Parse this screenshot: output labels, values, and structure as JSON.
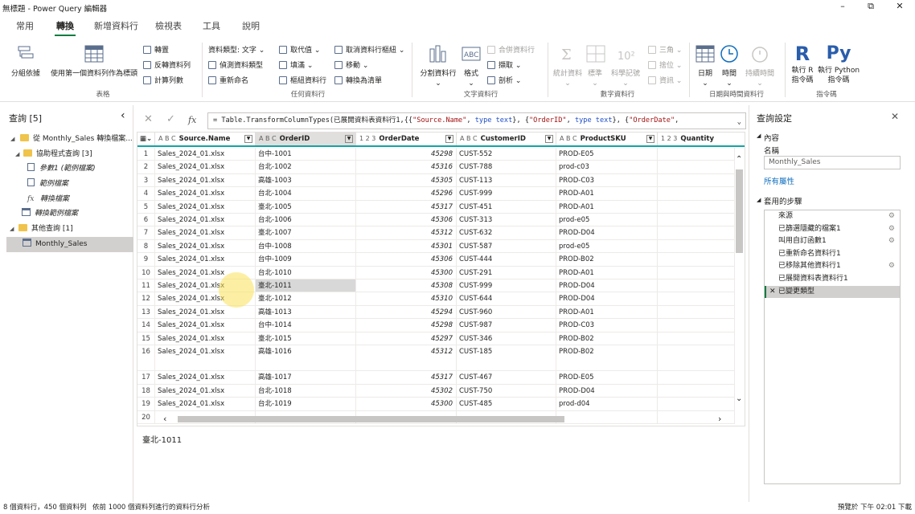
{
  "window": {
    "title": "無標題 - Power Query 編輯器",
    "min": "–",
    "max": "⧉",
    "close": "✕"
  },
  "tabs": [
    {
      "label": "常用"
    },
    {
      "label": "轉換"
    },
    {
      "label": "新增資料行"
    },
    {
      "label": "檢視表"
    },
    {
      "label": "工具"
    },
    {
      "label": "說明"
    }
  ],
  "ribbon": {
    "table": {
      "group": "表格",
      "group_by": "分組依據",
      "first_row": "使用第一個資料列作為標頭",
      "transpose": "轉置",
      "reverse": "反轉資料列",
      "count": "計算列數"
    },
    "any": {
      "group": "任何資料行",
      "dtype": "資料類型: 文字",
      "detect": "偵測資料類型",
      "rename": "重新命名",
      "replace": "取代值",
      "fill": "填滿",
      "pivot": "樞紐資料行",
      "unpivot": "取消資料行樞紐",
      "move": "移動",
      "to_list": "轉換為清單"
    },
    "text": {
      "group": "文字資料行",
      "split": "分割資料行",
      "format": "格式",
      "merge": "合併資料行",
      "extract": "擷取",
      "parse": "剖析"
    },
    "number": {
      "group": "數字資料行",
      "stats": "統計資料",
      "standard": "標準",
      "scientific": "科學記號",
      "trig": "三角",
      "rounding": "捨位",
      "info": "資訊"
    },
    "datetime": {
      "group": "日期與時間資料行",
      "date": "日期",
      "time": "時間",
      "duration": "持續時間"
    },
    "scripts": {
      "group": "指令碼",
      "run_r": "執行 R 指令碼",
      "run_py": "執行 Python 指令碼"
    }
  },
  "queries": {
    "title": "查詢 [5]",
    "collapse": "‹",
    "items": [
      {
        "label": "從 Monthly_Sales 轉換檔案...",
        "kind": "folder",
        "level": 0
      },
      {
        "label": "協助程式查詢 [3]",
        "kind": "folder",
        "level": 1
      },
      {
        "label": "參數1 (範例檔案)",
        "kind": "param",
        "level": 2
      },
      {
        "label": "範例檔案",
        "kind": "param",
        "level": 2
      },
      {
        "label": "轉換檔案",
        "kind": "fx",
        "level": 2
      },
      {
        "label": "轉換範例檔案",
        "kind": "table",
        "level": 1
      },
      {
        "label": "其他查詢 [1]",
        "kind": "folder",
        "level": 0
      },
      {
        "label": "Monthly_Sales",
        "kind": "table",
        "level": 1,
        "selected": true
      }
    ]
  },
  "formula": {
    "text_prefix": "= Table.TransformColumnTypes(已展開資料表資料行1,{{",
    "s1": "\"Source.Name\"",
    "t1": "type text",
    "s2": "\"OrderID\"",
    "t2": "type text",
    "s3": "\"OrderDate\""
  },
  "grid": {
    "columns": [
      {
        "type": "A B C",
        "name": "Source.Name"
      },
      {
        "type": "A B C",
        "name": "OrderID"
      },
      {
        "type": "1 2 3",
        "name": "OrderDate"
      },
      {
        "type": "A B C",
        "name": "CustomerID"
      },
      {
        "type": "A B C",
        "name": "ProductSKU"
      },
      {
        "type": "1 2 3",
        "name": "Quantity"
      }
    ],
    "rows": [
      [
        "1",
        "Sales_2024_01.xlsx",
        "台中-1001",
        "45298",
        "CUST-552",
        "PROD-E05"
      ],
      [
        "2",
        "Sales_2024_01.xlsx",
        "台北-1002",
        "45316",
        "CUST-788",
        "prod-c03"
      ],
      [
        "3",
        "Sales_2024_01.xlsx",
        "高雄-1003",
        "45305",
        "CUST-113",
        "PROD-C03"
      ],
      [
        "4",
        "Sales_2024_01.xlsx",
        "台北-1004",
        "45296",
        "CUST-999",
        "PROD-A01"
      ],
      [
        "5",
        "Sales_2024_01.xlsx",
        "臺北-1005",
        "45317",
        "CUST-451",
        "PROD-A01"
      ],
      [
        "6",
        "Sales_2024_01.xlsx",
        "台北-1006",
        "45306",
        "CUST-313",
        "prod-e05"
      ],
      [
        "7",
        "Sales_2024_01.xlsx",
        "臺北-1007",
        "45312",
        "CUST-632",
        "PROD-D04"
      ],
      [
        "8",
        "Sales_2024_01.xlsx",
        "台中-1008",
        "45301",
        "CUST-587",
        "prod-e05"
      ],
      [
        "9",
        "Sales_2024_01.xlsx",
        "台中-1009",
        "45306",
        "CUST-444",
        "PROD-B02"
      ],
      [
        "10",
        "Sales_2024_01.xlsx",
        "台北-1010",
        "45300",
        "CUST-291",
        "PROD-A01"
      ],
      [
        "11",
        "Sales_2024_01.xlsx",
        "臺北-1011",
        "45308",
        "CUST-999",
        "PROD-D04"
      ],
      [
        "12",
        "Sales_2024_01.xlsx",
        "臺北-1012",
        "45310",
        "CUST-644",
        "PROD-D04"
      ],
      [
        "13",
        "Sales_2024_01.xlsx",
        "高雄-1013",
        "45294",
        "CUST-960",
        "PROD-A01"
      ],
      [
        "14",
        "Sales_2024_01.xlsx",
        "台中-1014",
        "45298",
        "CUST-987",
        "PROD-C03"
      ],
      [
        "15",
        "Sales_2024_01.xlsx",
        "臺北-1015",
        "45297",
        "CUST-346",
        "PROD-B02"
      ],
      [
        "16",
        "Sales_2024_01.xlsx",
        "高雄-1016",
        "45312",
        "CUST-185",
        "PROD-B02"
      ],
      [
        "17",
        "Sales_2024_01.xlsx",
        "高雄-1017",
        "45317",
        "CUST-467",
        "PROD-E05"
      ],
      [
        "18",
        "Sales_2024_01.xlsx",
        "台北-1018",
        "45302",
        "CUST-750",
        "PROD-D04"
      ],
      [
        "19",
        "Sales_2024_01.xlsx",
        "台北-1019",
        "45300",
        "CUST-485",
        "prod-d04"
      ],
      [
        "20",
        "",
        "",
        "",
        "",
        ""
      ]
    ]
  },
  "preview_value": "臺北-1011",
  "settings": {
    "title": "查詢設定",
    "close": "✕",
    "props_header": "內容",
    "name_label": "名稱",
    "name_value": "Monthly_Sales",
    "all_props": "所有屬性",
    "steps_header": "套用的步驟",
    "steps": [
      {
        "label": "來源",
        "gear": true
      },
      {
        "label": "已篩選隱藏的檔案1",
        "gear": true
      },
      {
        "label": "叫用自訂函數1",
        "gear": true
      },
      {
        "label": "已重新命名資料行1",
        "gear": false
      },
      {
        "label": "已移除其他資料行1",
        "gear": true
      },
      {
        "label": "已展開資料表資料行1",
        "gear": false
      },
      {
        "label": "已變更類型",
        "gear": false,
        "current": true
      }
    ]
  },
  "status": {
    "left": "8 個資料行，450 個資料列",
    "middle": "依前 1000 個資料列進行的資料行分析",
    "right": "預覽於 下午 02:01 下載"
  }
}
